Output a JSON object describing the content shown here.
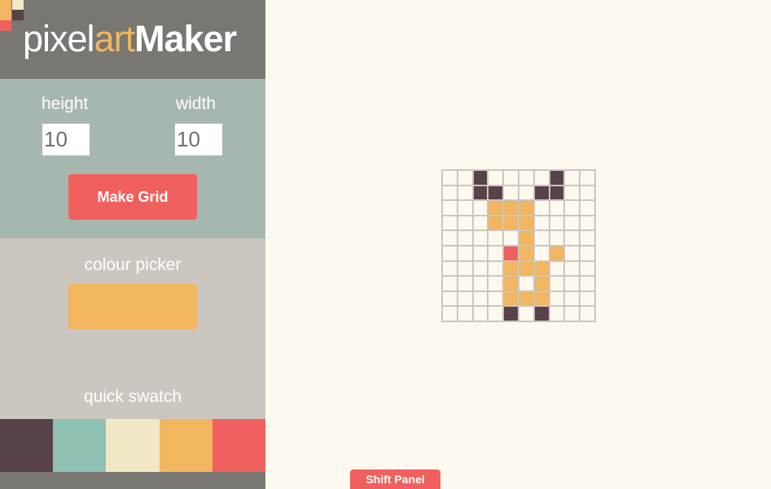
{
  "app": {
    "logo": {
      "part1": "pixel",
      "part2": "art",
      "part3": "Maker"
    },
    "logo_mark_colors": [
      "#f2b560",
      "#f1e9c6",
      "#564248",
      "#f0605e"
    ]
  },
  "size_controls": {
    "height_label": "height",
    "height_value": "10",
    "width_label": "width",
    "width_value": "10",
    "make_grid_label": "Make Grid"
  },
  "colour": {
    "label": "colour picker",
    "current": "#f2b560"
  },
  "swatch": {
    "label": "quick swatch",
    "colors": [
      "#564248",
      "#8fc1b5",
      "#f1e9c6",
      "#f2b560",
      "#f0605e"
    ]
  },
  "grid": {
    "rows": 10,
    "cols": 10,
    "palette": {
      "d": "#564248",
      "o": "#f2b560",
      "r": "#f0605e",
      ".": ""
    },
    "pixels": [
      "..d....d..",
      "..dd..dd..",
      "...ooo....",
      "...ooo....",
      ".....o....",
      "....ro.o..",
      "....ooo...",
      "....o.o...",
      "....ooo...",
      "....d.d..."
    ]
  },
  "shift_panel_label": "Shift Panel"
}
